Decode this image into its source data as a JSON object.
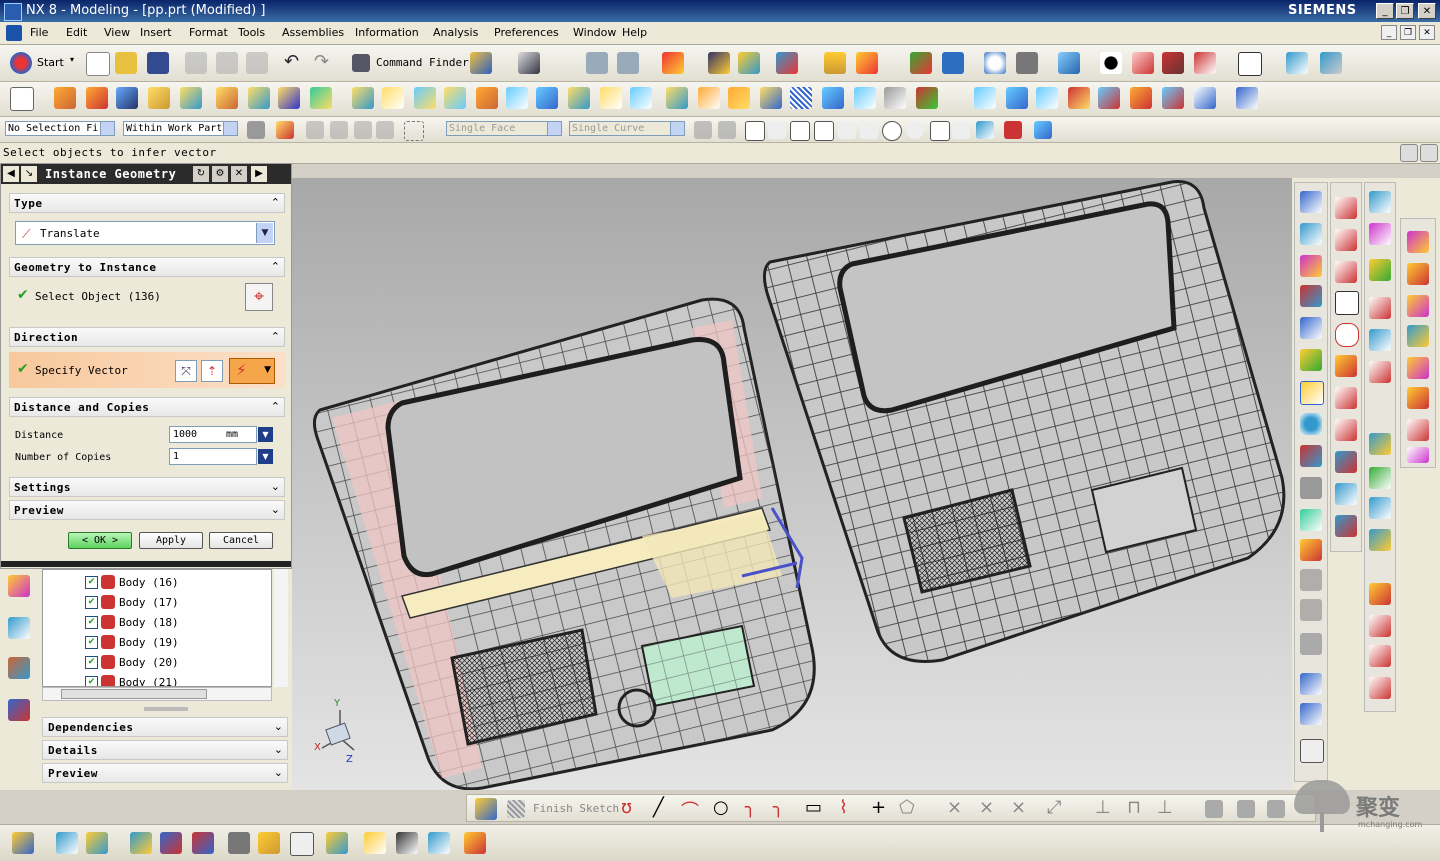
{
  "window": {
    "title": "NX 8 - Modeling - [pp.prt (Modified) ]",
    "brand": "SIEMENS",
    "controls": [
      "_",
      "❐",
      "✕"
    ]
  },
  "menu": {
    "items": [
      "File",
      "Edit",
      "View",
      "Insert",
      "Format",
      "Tools",
      "Assemblies",
      "Information",
      "Analysis",
      "Preferences",
      "Window",
      "Help"
    ],
    "mdi_controls": [
      "_",
      "❐",
      "✕"
    ]
  },
  "toolbar": {
    "start_label": "Start",
    "command_finder_label": "Command Finder"
  },
  "selection_bar": {
    "type_filter": "No Selection Fi",
    "scope": "Within Work Part",
    "face_rule": "Single Face",
    "curve_rule": "Single Curve"
  },
  "cue_line": "Select objects to infer vector",
  "dialog": {
    "title": "Instance Geometry",
    "sections": {
      "type": "Type",
      "geometry": "Geometry to Instance",
      "direction": "Direction",
      "distance_copies": "Distance and Copies",
      "settings": "Settings",
      "preview": "Preview"
    },
    "type_value": "Translate",
    "select_object_label": "Select Object (136)",
    "specify_vector_label": "Specify Vector",
    "distance_label": "Distance",
    "distance_value": "1000",
    "distance_unit": "mm",
    "copies_label": "Number of Copies",
    "copies_value": "1",
    "buttons": {
      "ok": "< OK >",
      "apply": "Apply",
      "cancel": "Cancel"
    }
  },
  "navigator": {
    "rows": [
      {
        "label": "Body (16)"
      },
      {
        "label": "Body (17)"
      },
      {
        "label": "Body (18)"
      },
      {
        "label": "Body (19)"
      },
      {
        "label": "Body (20)"
      },
      {
        "label": "Body (21)"
      }
    ],
    "panels": {
      "dependencies": "Dependencies",
      "details": "Details",
      "preview": "Preview"
    }
  },
  "triad": {
    "x": "X",
    "y": "Y",
    "z": "Z"
  },
  "sketch_toolbar": {
    "finish_label": "Finish Sketch"
  },
  "watermark": {
    "text": "聚变",
    "sub": "mchanging.com"
  },
  "colors": {
    "title_bar": "#0a246a",
    "dialog_header": "#2b2b2b",
    "vector_highlight": "#f8c89c",
    "check_green": "#21a121",
    "ok_button": "#7ce07c"
  }
}
